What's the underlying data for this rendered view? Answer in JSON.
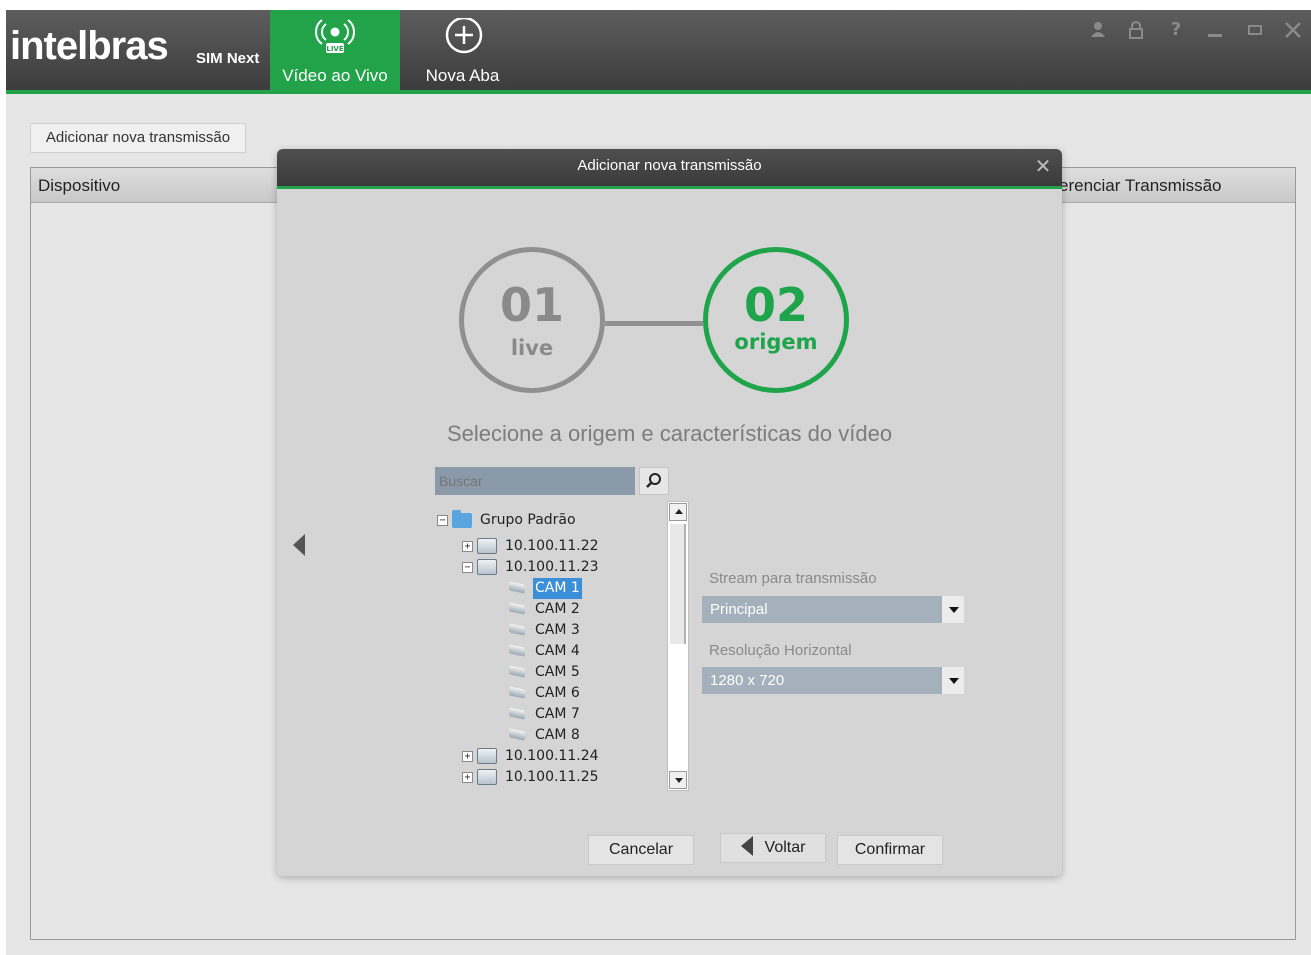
{
  "app": {
    "logo": "intelbras",
    "product": "SIM Next",
    "tabs": [
      {
        "label": "Vídeo ao Vivo",
        "icon": "live-broadcast-icon",
        "active": true
      },
      {
        "label": "Nova Aba",
        "icon": "plus-circle-icon",
        "active": false
      }
    ],
    "window_controls": [
      "user-icon",
      "lock-icon",
      "help-icon",
      "minimize-icon",
      "maximize-icon",
      "close-icon"
    ],
    "accent_color": "#22a34a"
  },
  "page": {
    "add_button_label": "Adicionar nova transmissão",
    "table_headers": [
      "Dispositivo",
      "erenciar Transmissão"
    ]
  },
  "modal": {
    "title": "Adicionar nova transmissão",
    "steps": [
      {
        "number": "01",
        "label": "live",
        "active": false
      },
      {
        "number": "02",
        "label": "origem",
        "active": true
      }
    ],
    "instructions": "Selecione a origem e características do vídeo",
    "search_placeholder": "Buscar",
    "tree": {
      "group": "Grupo Padrão",
      "devices": [
        {
          "name": "10.100.11.22",
          "expanded": false
        },
        {
          "name": "10.100.11.23",
          "expanded": true,
          "cameras": [
            "CAM 1",
            "CAM 2",
            "CAM 3",
            "CAM 4",
            "CAM 5",
            "CAM 6",
            "CAM 7",
            "CAM 8"
          ],
          "selected": "CAM 1"
        },
        {
          "name": "10.100.11.24",
          "expanded": false
        },
        {
          "name": "10.100.11.25",
          "expanded": false
        }
      ]
    },
    "stream_label": "Stream para transmissão",
    "stream_value": "Principal",
    "resolution_label": "Resolução Horizontal",
    "resolution_value": "1280 x 720",
    "buttons": {
      "cancel": "Cancelar",
      "back": "Voltar",
      "confirm": "Confirmar"
    }
  }
}
